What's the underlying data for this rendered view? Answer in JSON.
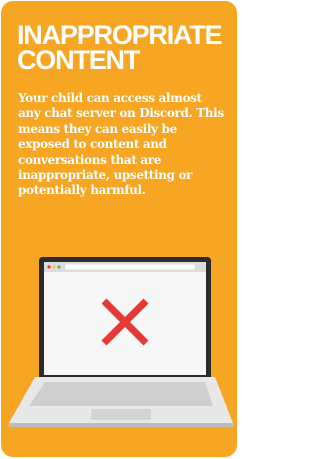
{
  "card": {
    "title_line1": "INAPPROPRIATE",
    "title_line2": "CONTENT",
    "body": "Your child can access almost any chat server on Discord. This means they can easily be exposed to content and conversations that are inappropriate, upsetting or potentially harmful."
  },
  "illustration": {
    "icon": "laptop-with-red-x-icon"
  },
  "colors": {
    "background": "#f6a623",
    "text": "#ffffff",
    "x_mark": "#e53935",
    "laptop_body": "#e8e8e8",
    "laptop_bezel": "#2b2b2b"
  }
}
